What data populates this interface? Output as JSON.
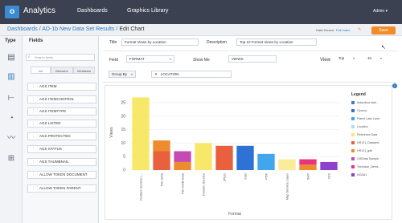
{
  "app": {
    "logo_letter": "o",
    "title": "Analytics"
  },
  "nav": {
    "dashboards": "Dashboards",
    "graphics_library": "Graphics Library",
    "admin": "Admin ▾"
  },
  "breadcrumb": {
    "part1": "Dashboards",
    "sep": " / ",
    "part2": "AD-1b New Data Set Results",
    "part3": "Edit Chart"
  },
  "data_source": {
    "label": "Data Source:",
    "value": "Full Index",
    "edit_icon": "pencil-icon"
  },
  "save_label": "Save",
  "type_panel": {
    "header": "Type",
    "icons": [
      "table-icon",
      "bar-chart-icon",
      "hierarchy-icon",
      "pie-chart-icon",
      "line-chart-icon",
      "grid-icon"
    ]
  },
  "fields_panel": {
    "header": "Fields",
    "search_placeholder": "Search fields",
    "tabs": [
      "All",
      "Behavior",
      "Metadata"
    ],
    "items": [
      "AGS ITEM",
      "AGS ITEMCONTROL",
      "AGS ITEMTYPE",
      "AGS LISTED",
      "AGS PROTECTED",
      "AGS STATUS",
      "AGS THUMBNAIL",
      "ALLOW TOKEN DOCUMENT",
      "ALLOW TOKEN PARENT"
    ]
  },
  "form": {
    "title_label": "Title",
    "title_value": "Format Views by Location",
    "description_label": "Description",
    "description_value": "Top 10 Format Views by Location",
    "field_label": "Field",
    "field_value": "FORMAT",
    "show_me_label": "Show Me",
    "show_me_value": "VIEWS",
    "view_label": "View",
    "view_value": "Top",
    "view_count": "10",
    "group_by_label": "Group By",
    "group_by_value": "LOCATION"
  },
  "chart_data": {
    "type": "bar",
    "xlabel": "Format",
    "ylabel": "Views",
    "ylim": [
      0,
      28
    ],
    "yticks": [
      0,
      5,
      10,
      15,
      20,
      25
    ],
    "categories": [
      "Feature Service (...",
      "File GDB",
      "File GDB Data",
      "Feature Service",
      "JPEG",
      "Intel",
      "PDF",
      "Map Service Layer",
      "SHP",
      "GIS"
    ],
    "series": [
      {
        "name": "Reference Data",
        "color": "#f7e86a",
        "values": [
          27,
          0,
          0,
          10,
          0,
          0,
          0,
          0,
          0,
          0
        ]
      },
      {
        "name": "Location",
        "color": "#fbec9a",
        "values": [
          0,
          0,
          0,
          0,
          0,
          0,
          0,
          4,
          0,
          0
        ]
      },
      {
        "name": "HR121_Datasets",
        "color": "#e9603f",
        "values": [
          0,
          7,
          0,
          0,
          9,
          0,
          0,
          0,
          0,
          0
        ]
      },
      {
        "name": "HR121_gdb",
        "color": "#ef8b2f",
        "values": [
          0,
          4,
          3,
          0,
          0,
          0,
          0,
          0,
          2,
          0
        ]
      },
      {
        "name": "GISData Sample",
        "color": "#c64ab3",
        "values": [
          0,
          0,
          4,
          0,
          0,
          0,
          0,
          0,
          0,
          0
        ]
      },
      {
        "name": "Technical_Direct",
        "color": "#e8347a",
        "values": [
          0,
          0,
          0,
          0,
          0,
          0,
          0,
          0,
          2,
          0
        ]
      },
      {
        "name": "NOAA1",
        "color": "#8e3fd0",
        "values": [
          0,
          0,
          0,
          0,
          0,
          0,
          0,
          0,
          0,
          3
        ]
      },
      {
        "name": "Cinema",
        "color": "#2e72d6",
        "values": [
          0,
          0,
          0,
          0,
          0,
          9,
          0,
          0,
          0,
          0
        ]
      },
      {
        "name": "Planet Labs Land",
        "color": "#43a6ec",
        "values": [
          0,
          0,
          0,
          0,
          0,
          0,
          6,
          0,
          0,
          0
        ]
      },
      {
        "name": "Antarctica stat...",
        "color": "#5576c8",
        "values": [
          0,
          0,
          0,
          0,
          0,
          0,
          0,
          0,
          0,
          0
        ]
      }
    ],
    "legend": {
      "title": "Legend",
      "placement": "right",
      "entries": [
        {
          "name": "Antarctica stati...",
          "color": "#5576c8"
        },
        {
          "name": "Cinema",
          "color": "#2e72d6"
        },
        {
          "name": "Planet Labs Land",
          "color": "#43a6ec"
        },
        {
          "name": "Location",
          "color": "#a8e0f7"
        },
        {
          "name": "Reference Data",
          "color": "#f7e86a"
        },
        {
          "name": "HR121_Datasets",
          "color": "#e9603f"
        },
        {
          "name": "HR121_gdb",
          "color": "#ef8b2f"
        },
        {
          "name": "GISData Sample",
          "color": "#c64ab3"
        },
        {
          "name": "Technical_Direct...",
          "color": "#e8347a"
        },
        {
          "name": "NOAA1",
          "color": "#8e3fd0"
        }
      ]
    },
    "grid": true
  }
}
